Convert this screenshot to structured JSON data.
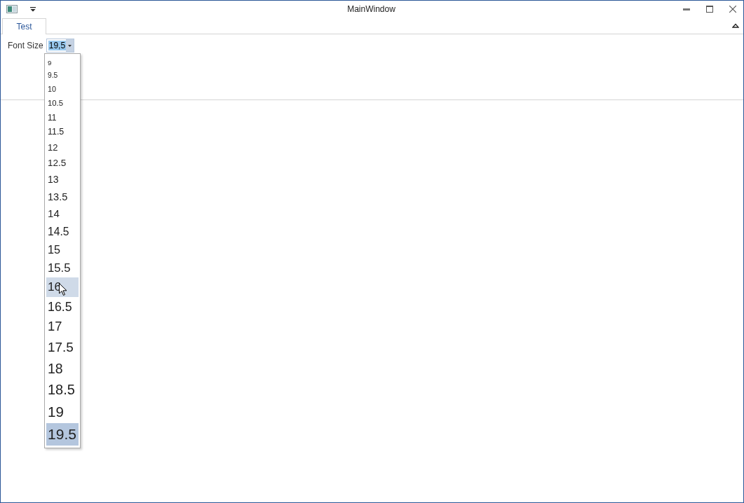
{
  "window": {
    "title": "MainWindow"
  },
  "tabs": [
    {
      "label": "Test",
      "selected": true
    }
  ],
  "font_size": {
    "label": "Font Size",
    "value": "19,5",
    "expanded": true,
    "options": [
      {
        "label": "9",
        "selected": false,
        "hovered": false
      },
      {
        "label": "9.5",
        "selected": false,
        "hovered": false
      },
      {
        "label": "10",
        "selected": false,
        "hovered": false
      },
      {
        "label": "10.5",
        "selected": false,
        "hovered": false
      },
      {
        "label": "11",
        "selected": false,
        "hovered": false
      },
      {
        "label": "11.5",
        "selected": false,
        "hovered": false
      },
      {
        "label": "12",
        "selected": false,
        "hovered": false
      },
      {
        "label": "12.5",
        "selected": false,
        "hovered": false
      },
      {
        "label": "13",
        "selected": false,
        "hovered": false
      },
      {
        "label": "13.5",
        "selected": false,
        "hovered": false
      },
      {
        "label": "14",
        "selected": false,
        "hovered": false
      },
      {
        "label": "14.5",
        "selected": false,
        "hovered": false
      },
      {
        "label": "15",
        "selected": false,
        "hovered": false
      },
      {
        "label": "15.5",
        "selected": false,
        "hovered": false
      },
      {
        "label": "16",
        "selected": false,
        "hovered": true
      },
      {
        "label": "16.5",
        "selected": false,
        "hovered": false
      },
      {
        "label": "17",
        "selected": false,
        "hovered": false
      },
      {
        "label": "17.5",
        "selected": false,
        "hovered": false
      },
      {
        "label": "18",
        "selected": false,
        "hovered": false
      },
      {
        "label": "18.5",
        "selected": false,
        "hovered": false
      },
      {
        "label": "19",
        "selected": false,
        "hovered": false
      },
      {
        "label": "19.5",
        "selected": true,
        "hovered": false
      }
    ]
  }
}
